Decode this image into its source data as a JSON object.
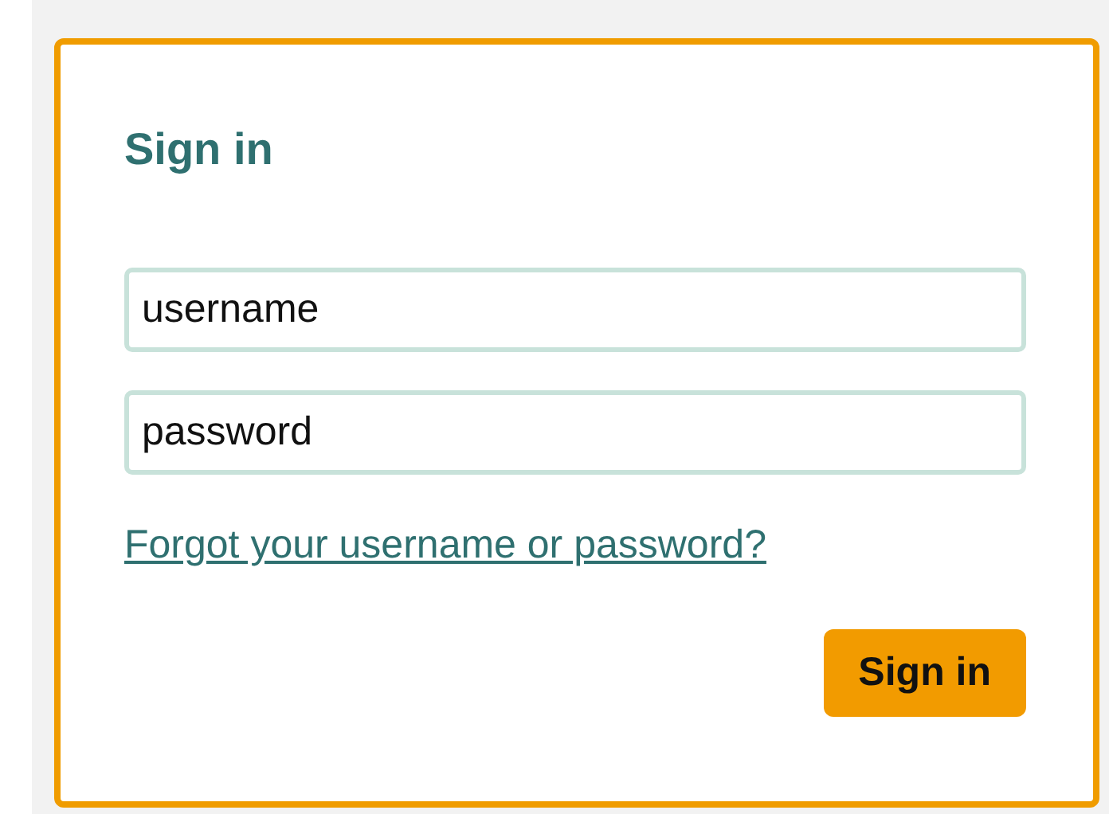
{
  "login": {
    "title": "Sign in",
    "fields": [
      {
        "placeholder": "username"
      },
      {
        "placeholder": "password"
      }
    ],
    "forgot_link": "Forgot your username or password?",
    "submit": "Sign in"
  }
}
